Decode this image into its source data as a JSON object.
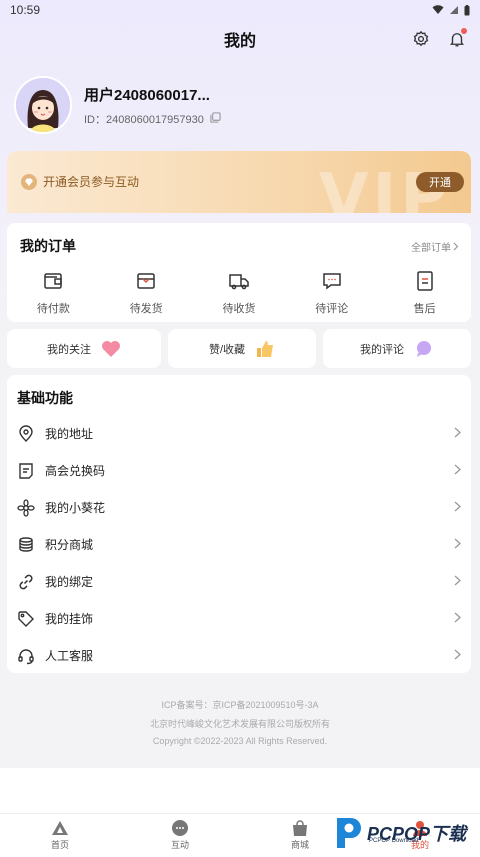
{
  "status_bar": {
    "time": "10:59"
  },
  "header": {
    "title": "我的"
  },
  "profile": {
    "username": "用户2408060017...",
    "uid": "ID：2408060017957930"
  },
  "vip": {
    "text": "开通会员参与互动",
    "button": "开通",
    "watermark": "VIP"
  },
  "orders": {
    "title": "我的订单",
    "all_label": "全部订单",
    "items": [
      {
        "label": "待付款",
        "icon": "wallet-icon"
      },
      {
        "label": "待发货",
        "icon": "package-icon"
      },
      {
        "label": "待收货",
        "icon": "truck-icon"
      },
      {
        "label": "待评论",
        "icon": "comment-icon"
      },
      {
        "label": "售后",
        "icon": "aftersale-icon"
      }
    ]
  },
  "quick": {
    "follow": "我的关注",
    "likes": "赞/收藏",
    "comments": "我的评论"
  },
  "basic": {
    "title": "基础功能",
    "items": [
      {
        "label": "我的地址",
        "icon": "location-icon"
      },
      {
        "label": "高会兑换码",
        "icon": "ticket-icon"
      },
      {
        "label": "我的小葵花",
        "icon": "flower-icon"
      },
      {
        "label": "积分商城",
        "icon": "coins-icon"
      },
      {
        "label": "我的绑定",
        "icon": "link-icon"
      },
      {
        "label": "我的挂饰",
        "icon": "tag-icon"
      },
      {
        "label": "人工客服",
        "icon": "headset-icon"
      }
    ]
  },
  "footer": {
    "icp": "ICP备案号：京ICP备2021009510号-3A",
    "company": "北京时代峰峻文化艺术发展有限公司版权所有",
    "copyright": "Copyright ©2022-2023 All Rights Reserved."
  },
  "tabbar": {
    "tabs": [
      {
        "label": "首页"
      },
      {
        "label": "互动"
      },
      {
        "label": "商城"
      },
      {
        "label": "我的"
      }
    ]
  },
  "watermark": {
    "text": "PCPOP下载",
    "sub": "PCPOP Download"
  },
  "colors": {
    "accent": "#e0533d",
    "vip_button": "#8e5c2a",
    "vip_text": "#8a5a23"
  }
}
